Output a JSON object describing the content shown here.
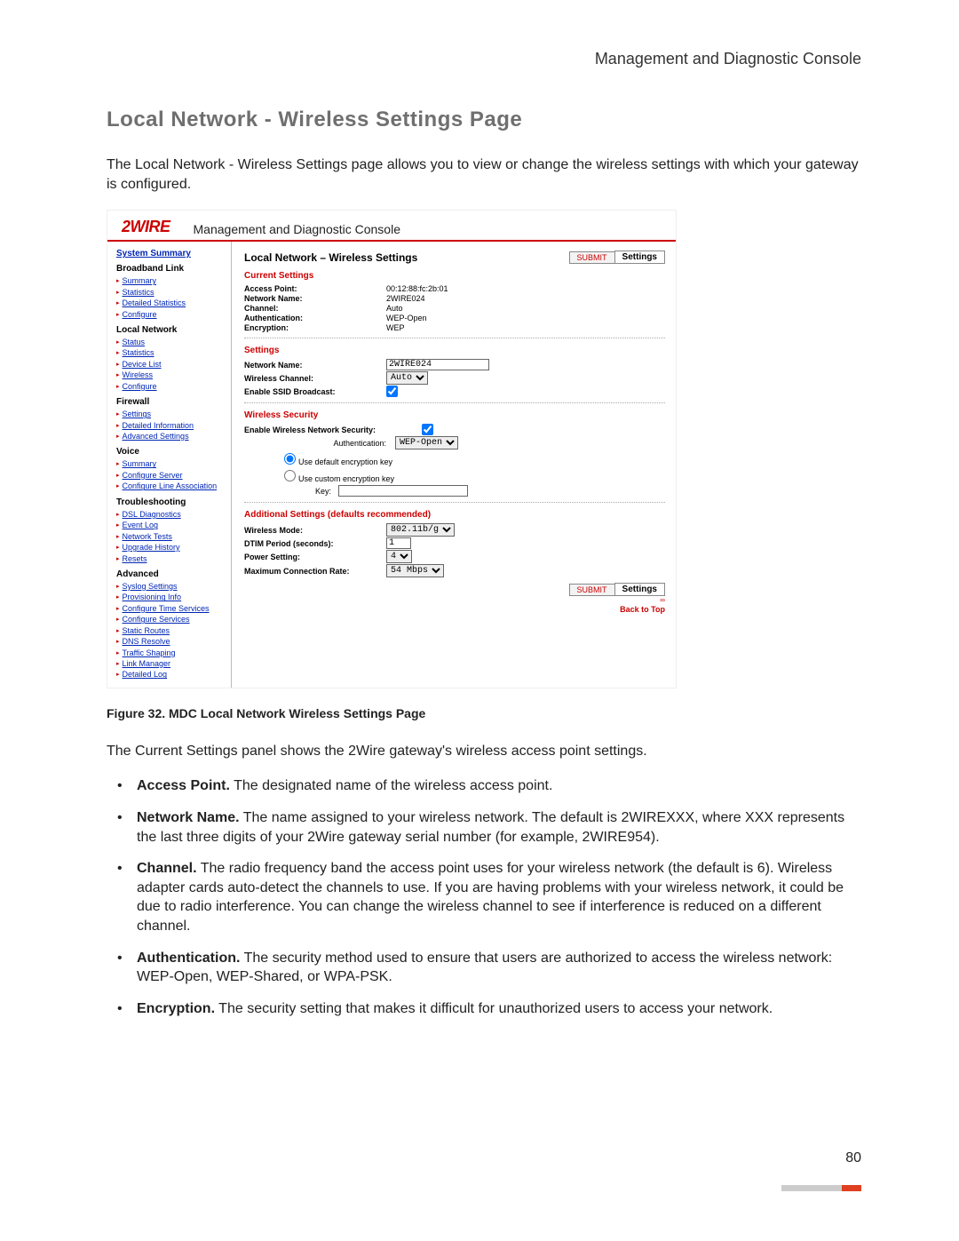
{
  "running_head": "Management and Diagnostic Console",
  "page_title": "Local Network - Wireless Settings Page",
  "intro_text": "The Local Network - Wireless Settings page allows you to view or change the wireless settings with which your gateway is configured.",
  "figure_caption": "Figure 32. MDC Local Network Wireless Settings Page",
  "body_after_figure": "The Current Settings panel shows the 2Wire gateway's wireless access point settings.",
  "bullets": {
    "b0_lead": "Access Point.",
    "b0_rest": " The designated name of the wireless access point.",
    "b1_lead": "Network Name.",
    "b1_rest": " The name assigned to your wireless network. The default is 2WIREXXX, where XXX represents the last three digits of your 2Wire gateway serial number (for example, 2WIRE954).",
    "b2_lead": "Channel.",
    "b2_rest": " The radio frequency band the access point uses for your wireless network (the default is 6). Wireless adapter cards auto-detect the channels to use. If you are having problems with your wireless network, it could be due to radio interference. You can change the wireless channel to see if interference is reduced on a different channel.",
    "b3_lead": "Authentication.",
    "b3_rest": " The security method used to ensure that users are authorized to access the wireless network: WEP-Open, WEP-Shared, or WPA-PSK.",
    "b4_lead": "Encryption.",
    "b4_rest": " The security setting that makes it difficult for unauthorized users to access your network."
  },
  "page_number": "80",
  "mdc": {
    "logo_text": "2WIRE",
    "console_title": "Management and Diagnostic Console",
    "sidebar": {
      "top_link": "System Summary",
      "sec0": "Broadband Link",
      "sec0_items": [
        "Summary",
        "Statistics",
        "Detailed Statistics",
        "Configure"
      ],
      "sec1": "Local Network",
      "sec1_items": [
        "Status",
        "Statistics",
        "Device List",
        "Wireless",
        "Configure"
      ],
      "sec2": "Firewall",
      "sec2_items": [
        "Settings",
        "Detailed Information",
        "Advanced Settings"
      ],
      "sec3": "Voice",
      "sec3_items": [
        "Summary",
        "Configure Server",
        "Configure Line Association"
      ],
      "sec4": "Troubleshooting",
      "sec4_items": [
        "DSL Diagnostics",
        "Event Log",
        "Network Tests",
        "Upgrade History",
        "Resets"
      ],
      "sec5": "Advanced",
      "sec5_items": [
        "Syslog Settings",
        "Provisioning Info",
        "Configure Time Services",
        "Configure Services",
        "Static Routes",
        "DNS Resolve",
        "Traffic Shaping",
        "Link Manager",
        "Detailed Log"
      ]
    },
    "content": {
      "title": "Local Network – Wireless Settings",
      "submit_btn": "SUBMIT",
      "submit_label": "Settings",
      "current_head": "Current Settings",
      "cur": {
        "ap_k": "Access Point:",
        "ap_v": "00:12:88:fc:2b:01",
        "nn_k": "Network Name:",
        "nn_v": "2WIRE024",
        "ch_k": "Channel:",
        "ch_v": "Auto",
        "au_k": "Authentication:",
        "au_v": "WEP-Open",
        "en_k": "Encryption:",
        "en_v": "WEP"
      },
      "settings_head": "Settings",
      "set": {
        "nn_k": "Network Name:",
        "nn_v": "2WIRE024",
        "wc_k": "Wireless Channel:",
        "wc_v": "Auto",
        "sb_k": "Enable SSID Broadcast:"
      },
      "sec_head": "Wireless Security",
      "sec": {
        "en_k": "Enable Wireless Network Security:",
        "au_k": "Authentication:",
        "au_v": "WEP-Open",
        "r0": "Use default encryption key",
        "r1": "Use custom encryption key",
        "key_k": "Key:"
      },
      "add_head": "Additional Settings (defaults recommended)",
      "add": {
        "wm_k": "Wireless Mode:",
        "wm_v": "802.11b/g",
        "dt_k": "DTIM Period (seconds):",
        "dt_v": "1",
        "ps_k": "Power Setting:",
        "ps_v": "4",
        "mc_k": "Maximum Connection Rate:",
        "mc_v": "54 Mbps"
      },
      "cr0": "∞",
      "cr1": "Back to Top"
    }
  }
}
